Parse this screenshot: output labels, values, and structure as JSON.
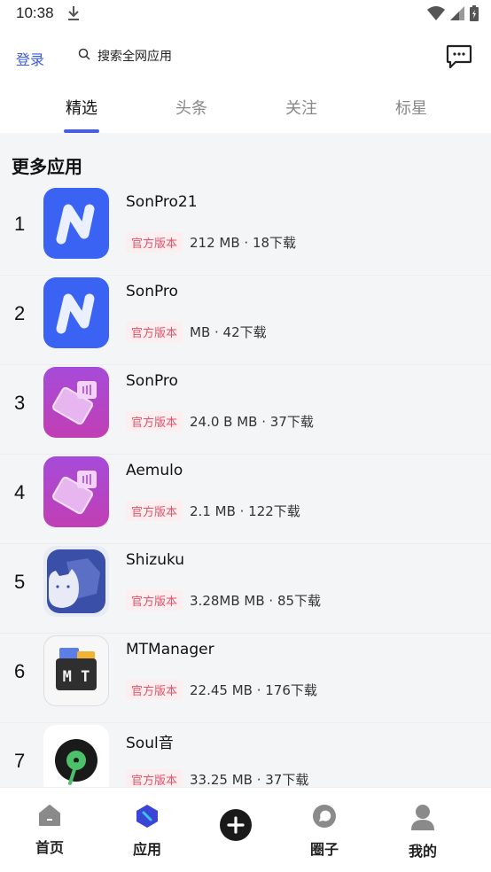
{
  "status": {
    "time": "10:38",
    "download_icon": "download-icon",
    "wifi_icon": "wifi-icon",
    "signal_icon": "signal-icon",
    "battery_icon": "battery-icon"
  },
  "header": {
    "login_label": "登录",
    "search_placeholder": "搜索全网应用",
    "message_icon": "message-icon"
  },
  "tabs": [
    {
      "label": "精选",
      "active": true
    },
    {
      "label": "头条",
      "active": false
    },
    {
      "label": "关注",
      "active": false
    },
    {
      "label": "标星",
      "active": false
    }
  ],
  "section": {
    "title": "更多应用"
  },
  "apps": [
    {
      "rank": "1",
      "name": "SonPro21",
      "badge": "官方版本",
      "stats": "212 MB · 18下载",
      "icon": "sonpro-n-icon"
    },
    {
      "rank": "2",
      "name": "SonPro",
      "badge": "官方版本",
      "stats": "MB · 42下载",
      "icon": "sonpro-n-icon"
    },
    {
      "rank": "3",
      "name": "SonPro",
      "badge": "官方版本",
      "stats": "24.0 B MB · 37下载",
      "icon": "nfc-card-icon"
    },
    {
      "rank": "4",
      "name": "Aemulo",
      "badge": "官方版本",
      "stats": "2.1 MB · 122下载",
      "icon": "nfc-card-icon"
    },
    {
      "rank": "5",
      "name": "Shizuku",
      "badge": "官方版本",
      "stats": "3.28MB MB · 85下载",
      "icon": "shizuku-icon"
    },
    {
      "rank": "6",
      "name": "MTManager",
      "badge": "官方版本",
      "stats": "22.45 MB · 176下载",
      "icon": "mt-manager-icon"
    },
    {
      "rank": "7",
      "name": "Soul音",
      "badge": "官方版本",
      "stats": "33.25 MB · 37下载",
      "icon": "soul-music-icon"
    }
  ],
  "bottom_nav": {
    "home": "首页",
    "apps": "应用",
    "circle": "圈子",
    "mine": "我的",
    "add_icon": "add-icon"
  },
  "colors": {
    "accent": "#4a5fe0",
    "link": "#3c5bdb",
    "badge_text": "#e0536a",
    "badge_bg": "#fdeef0",
    "list_bg": "#f4f5f7"
  }
}
